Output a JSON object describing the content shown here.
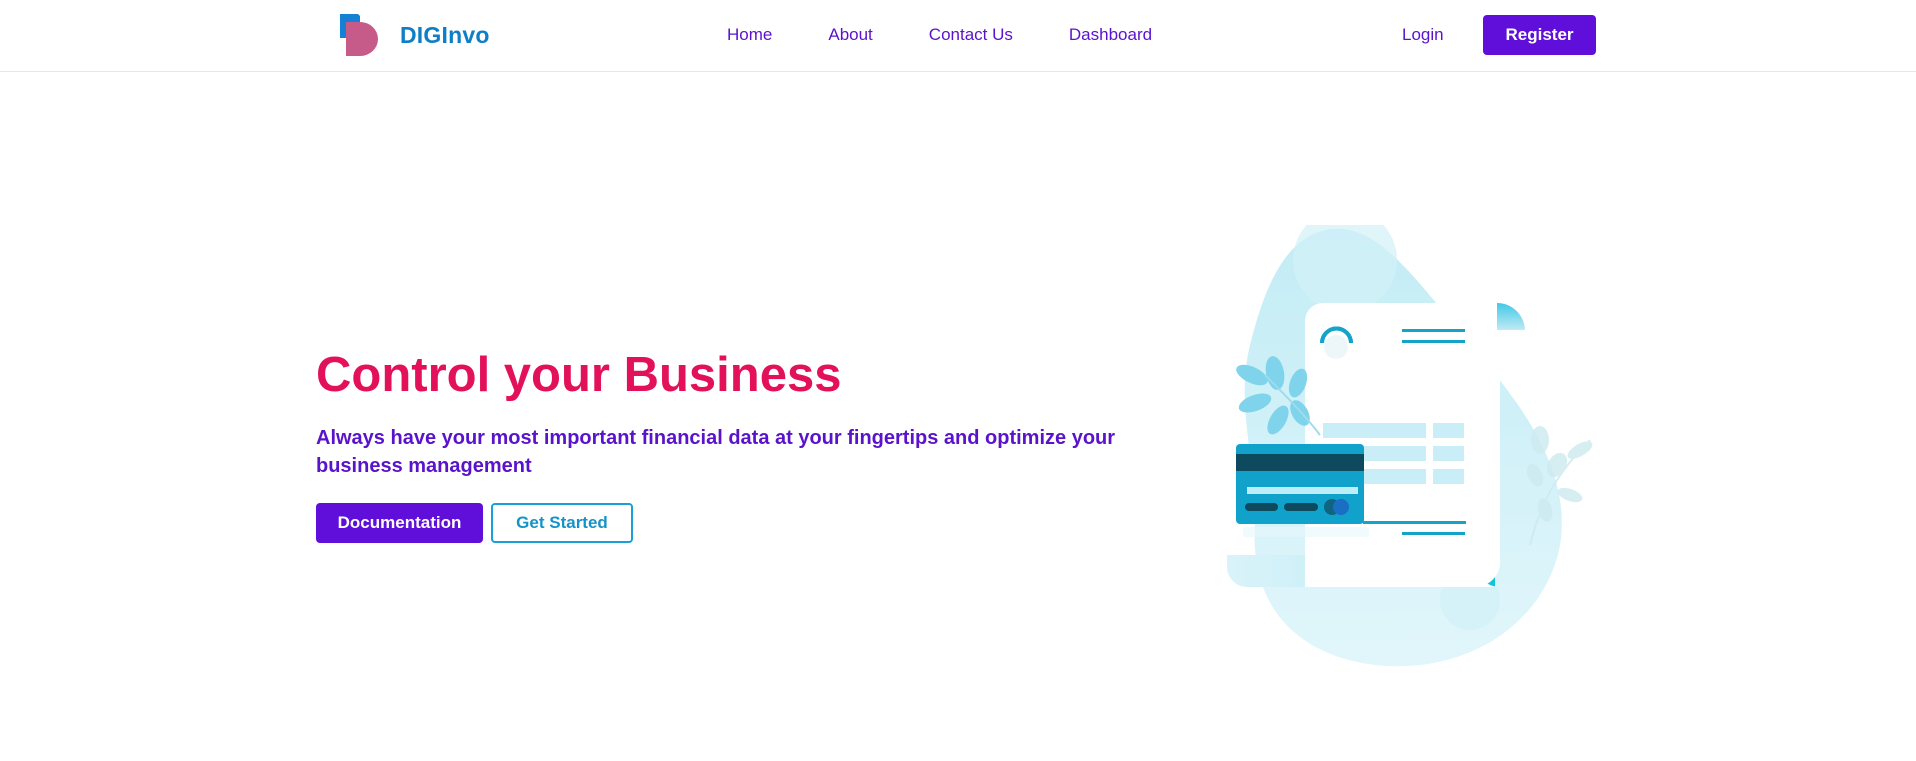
{
  "brand": {
    "name": "DIGInvo",
    "logo_icon": "d-logo-icon",
    "colors": {
      "blue": "#0e7ec6",
      "pink": "#c65a89"
    }
  },
  "nav": {
    "links": [
      {
        "label": "Home"
      },
      {
        "label": "About"
      },
      {
        "label": "Contact Us"
      },
      {
        "label": "Dashboard"
      }
    ],
    "login_label": "Login",
    "register_label": "Register"
  },
  "hero": {
    "title": "Control your Business",
    "subtitle": "Always have your most important financial data at your fingertips and optimize your business management",
    "primary_button": "Documentation",
    "secondary_button": "Get Started",
    "illustration_icon": "invoice-card-illustration"
  },
  "colors": {
    "accent": "#5f0fd9",
    "title": "#e2115a",
    "link": "#5a13cc",
    "outline": "#1aa0d6"
  }
}
